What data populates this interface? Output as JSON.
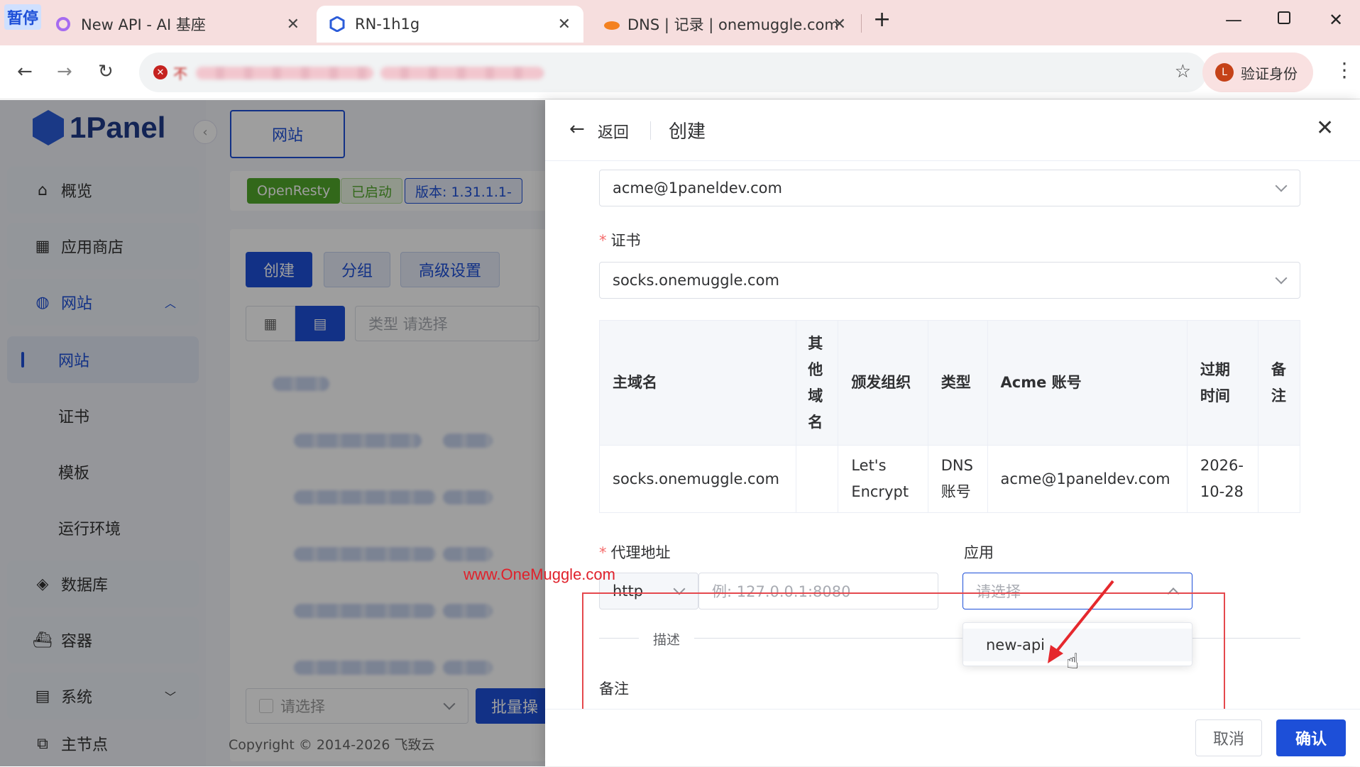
{
  "browser": {
    "pause_badge": "暂停",
    "tabs": [
      {
        "title": "New API - AI 基座",
        "active": false
      },
      {
        "title": "RN-1h1g",
        "active": true
      },
      {
        "title": "DNS | 记录 | onemuggle.com",
        "active": false
      }
    ],
    "new_tab": "+",
    "omnibox_security": "不",
    "verify_label": "验证身份",
    "verify_avatar": "L"
  },
  "sidebar": {
    "logo": "1Panel",
    "items": [
      {
        "label": "概览",
        "icon": "home-icon"
      },
      {
        "label": "应用商店",
        "icon": "grid-icon"
      },
      {
        "label": "网站",
        "icon": "globe-icon"
      },
      {
        "label": "数据库",
        "icon": "layers-icon"
      },
      {
        "label": "容器",
        "icon": "docker-icon"
      },
      {
        "label": "系统",
        "icon": "system-icon"
      },
      {
        "label": "主节点",
        "icon": "node-icon"
      }
    ],
    "subitems": [
      "网站",
      "证书",
      "模板",
      "运行环境"
    ]
  },
  "page": {
    "top_tab": "网站",
    "tag_openresty": "OpenResty",
    "tag_status": "已启动",
    "tag_version": "版本: 1.31.1.1-",
    "btn_create": "创建",
    "btn_group": "分组",
    "btn_advanced": "高级设置",
    "filter_placeholder": "类型  请选择",
    "bottom_select": "请选择",
    "bottom_batch": "批量操",
    "copyright": "Copyright © 2014-2026 飞致云"
  },
  "drawer": {
    "back_label": "返回",
    "title": "创建",
    "acme_value": "acme@1paneldev.com",
    "cert_label": "证书",
    "cert_value": "socks.onemuggle.com",
    "table": {
      "headers": [
        "主域名",
        "其他域名",
        "颁发组织",
        "类型",
        "Acme 账号",
        "过期时间",
        "备注"
      ],
      "rows": [
        [
          "socks.onemuggle.com",
          "",
          "Let's Encrypt",
          "DNS 账号",
          "acme@1paneldev.com",
          "2026-10-28",
          ""
        ]
      ]
    },
    "proxy_label": "代理地址",
    "proxy_scheme": "http",
    "proxy_placeholder": "例: 127.0.0.1:8080",
    "app_label": "应用",
    "app_placeholder": "请选择",
    "app_options": [
      "new-api"
    ],
    "desc_divider": "描述",
    "remark_label": "备注",
    "cancel": "取消",
    "confirm": "确认"
  },
  "watermark": "www.OneMuggle.com",
  "colors": {
    "primary": "#1d4fd8",
    "danger": "#e5484d",
    "openresty_tag": "#52a82a"
  }
}
